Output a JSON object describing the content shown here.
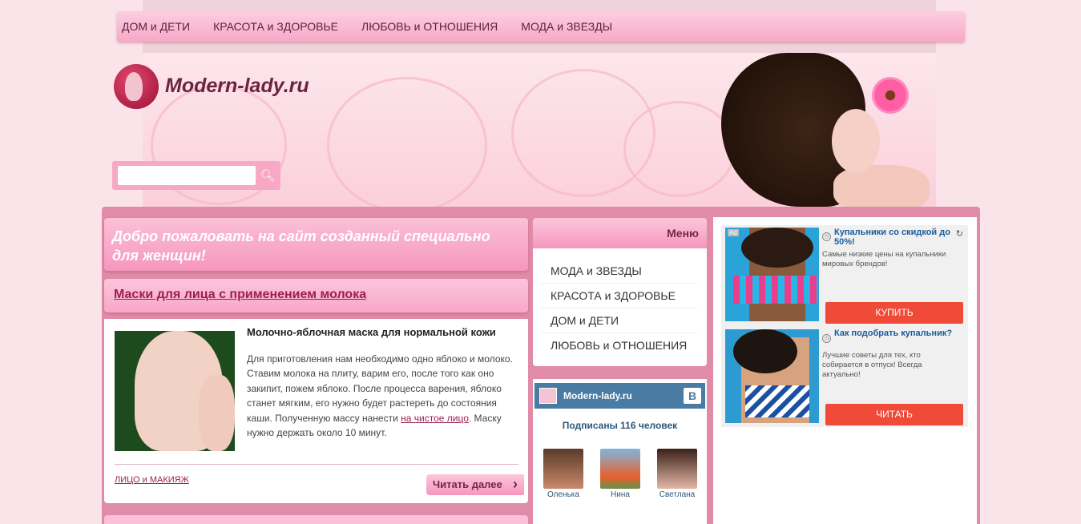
{
  "nav": {
    "items": [
      "ДОМ и ДЕТИ",
      "КРАСОТА и ЗДОРОВЬЕ",
      "ЛЮБОВЬ и ОТНОШЕНИЯ",
      "МОДА и ЗВЕЗДЫ"
    ]
  },
  "header": {
    "logo_text": "Modern-lady.ru",
    "search_placeholder": "",
    "search_icon": "search-icon"
  },
  "welcome": {
    "text": "Добро пожаловать на сайт созданный специально для женщин!"
  },
  "article": {
    "title": "Маски для лица с применением молока",
    "subtitle": "Молочно-яблочная маска для нормальной кожи",
    "text_before_link": "Для приготовления нам необходимо одно яблоко и молоко. Ставим молока на плиту, варим его, после того как оно закипит, пожем яблоко. После процесса варения, яблоко станет мягким, его нужно будет растереть до состояния каши. Полученную массу нанести ",
    "link_text": "на чистое лицо",
    "text_after_link": ". Маску нужно держать около 10 минут.",
    "tag": "ЛИЦО и МАКИЯЖ",
    "read_more": "Читать далее"
  },
  "menu": {
    "title": "Меню",
    "items": [
      "МОДА и ЗВЕЗДЫ",
      "КРАСОТА и ЗДОРОВЬЕ",
      "ДОМ и ДЕТИ",
      "ЛЮБОВЬ и ОТНОШЕНИЯ"
    ]
  },
  "vk": {
    "title": "Modern-lady.ru",
    "logo": "B",
    "count_text": "Подписаны 116 человек",
    "members": [
      "Оленька",
      "Нина",
      "Светлана"
    ]
  },
  "ads": {
    "mark": "Ad",
    "refresh_icon": "↻",
    "items": [
      {
        "title": "Купальники со скидкой до 50%!",
        "desc": "Самые низкие цены на купальники мировых брендов!",
        "button": "КУПИТЬ"
      },
      {
        "title": "Как подобрать купальник?",
        "desc": "Лучшие советы для тех, кто собирается в отпуск! Всегда актуально!",
        "button": "ЧИТАТЬ"
      }
    ]
  },
  "colors": {
    "accent_pink": "#f597bd",
    "title_color": "#9b1f52",
    "vk_blue": "#4a7ca3",
    "ad_button": "#f04a38"
  }
}
